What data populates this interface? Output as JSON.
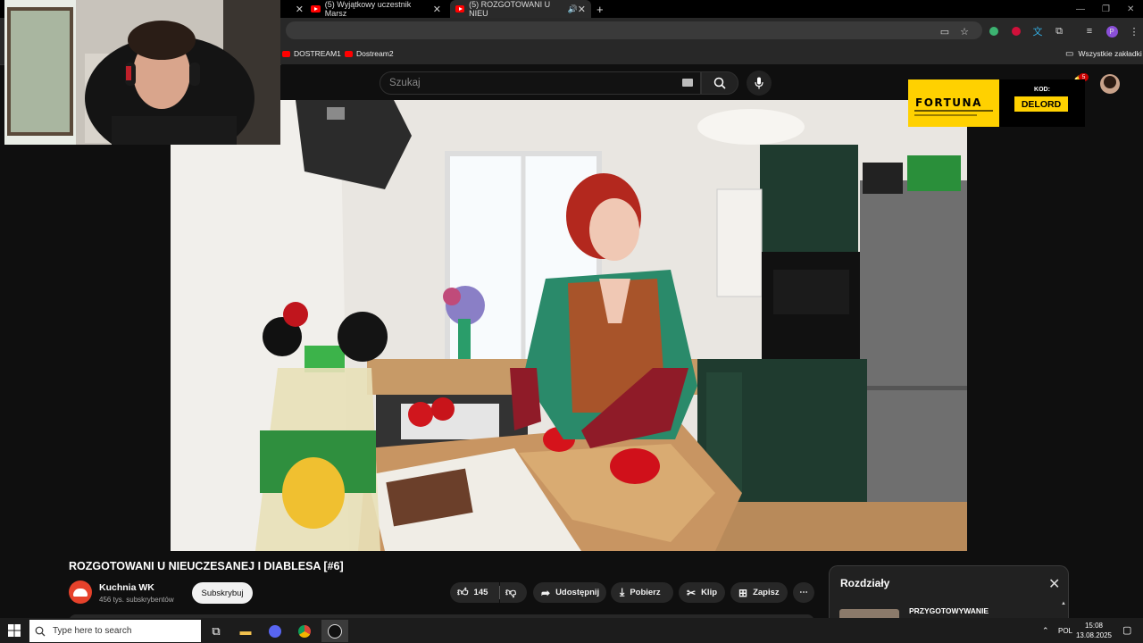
{
  "browser": {
    "tabs": [
      {
        "label": "(5) Wyjątkowy uczestnik Marsz",
        "active": false
      },
      {
        "label": "(5) ROZGOTOWANI U NIEU",
        "active": true
      }
    ],
    "new_tab_symbol": "+",
    "bookmarks": [
      "DOSTREAM1",
      "Dostream2"
    ],
    "all_bookmarks_label": "Wszystkie zakładki",
    "profile_letter": "P"
  },
  "youtube": {
    "search_placeholder": "Szukaj",
    "notification_count": "5",
    "video": {
      "title": "ROZGOTOWANI U NIEUCZESANEJ I DIABLESA [#6]",
      "channel_name": "Kuchnia WK",
      "channel_subscribers": "456 tys. subskrybentów",
      "subscribe_label": "Subskrybuj",
      "likes": "145",
      "share_label": "Udostępnij",
      "download_label": "Pobierz",
      "clip_label": "Klip",
      "save_label": "Zapisz",
      "more_label": "⋯"
    },
    "chapters": {
      "title": "Rozdziały",
      "items": [
        {
          "label": "PRZYGOTOWYWANIE"
        }
      ]
    }
  },
  "ad": {
    "brand": "FORTUNA",
    "code_label": "KOD:",
    "code": "DELORD",
    "colors": {
      "yellow": "#ffd100",
      "black": "#000000"
    }
  },
  "taskbar": {
    "search_placeholder": "Type here to search",
    "language": "POL",
    "time": "15:08",
    "date": "13.08.2025"
  }
}
